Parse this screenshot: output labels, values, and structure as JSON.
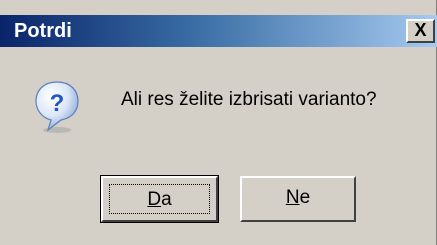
{
  "window": {
    "title": "Potrdi",
    "close_label": "X"
  },
  "dialog": {
    "icon": "question-icon",
    "message": "Ali res želite izbrisati varianto?"
  },
  "buttons": {
    "yes_mnemonic": "D",
    "yes_rest": "a",
    "no_mnemonic": "N",
    "no_rest": "e"
  },
  "colors": {
    "titlebar_start": "#0a246a",
    "titlebar_end": "#a6caf0",
    "face": "#d4d0c8",
    "icon_blue": "#1f57c3"
  }
}
